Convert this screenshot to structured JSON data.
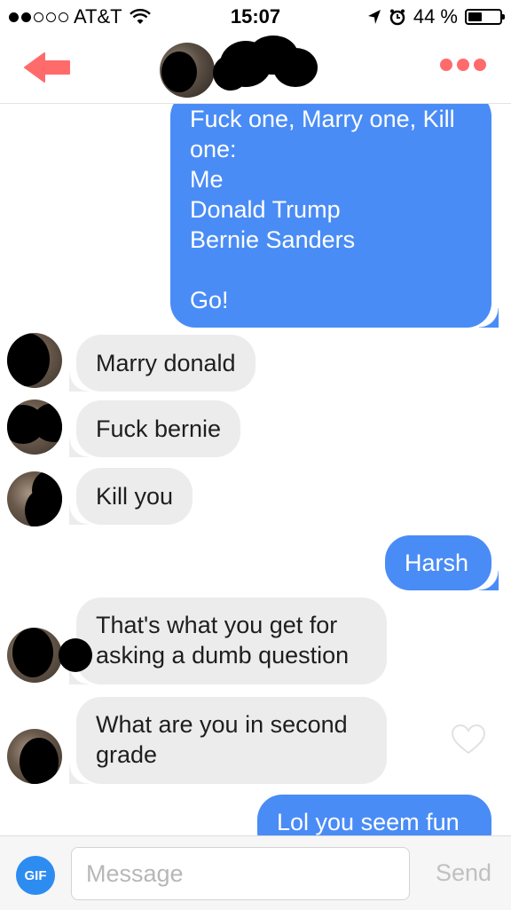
{
  "status_bar": {
    "carrier": "AT&T",
    "signal_bars_filled": 2,
    "signal_bars_total": 5,
    "time": "15:07",
    "battery": "44 %",
    "battery_level": 0.44
  },
  "header": {
    "back_icon": "back-arrow-icon",
    "more_icon": "more-dots-icon",
    "accent_color": "#ff6b6b"
  },
  "messages": [
    {
      "direction": "outgoing",
      "lines": [
        "Fuck one, Marry one, Kill",
        "one:",
        "Me",
        "Donald Trump",
        "Bernie Sanders",
        "",
        "Go!"
      ]
    },
    {
      "direction": "incoming",
      "lines": [
        "Marry donald"
      ]
    },
    {
      "direction": "incoming",
      "lines": [
        "Fuck bernie"
      ]
    },
    {
      "direction": "incoming",
      "lines": [
        "Kill you"
      ]
    },
    {
      "direction": "outgoing",
      "lines": [
        "Harsh"
      ]
    },
    {
      "direction": "incoming",
      "lines": [
        "That's what you get for",
        "asking a dumb question"
      ]
    },
    {
      "direction": "incoming",
      "lines": [
        "What are you in second",
        "grade"
      ],
      "like_icon": "heart-outline-icon"
    },
    {
      "direction": "outgoing",
      "lines": [
        "Lol you seem fun"
      ]
    }
  ],
  "colors": {
    "outgoing_bubble": "#4a8cf6",
    "incoming_bubble": "#ececec",
    "gif_button": "#2d8cf0"
  },
  "composer": {
    "gif_label": "GIF",
    "placeholder": "Message",
    "value": "",
    "send_label": "Send"
  }
}
